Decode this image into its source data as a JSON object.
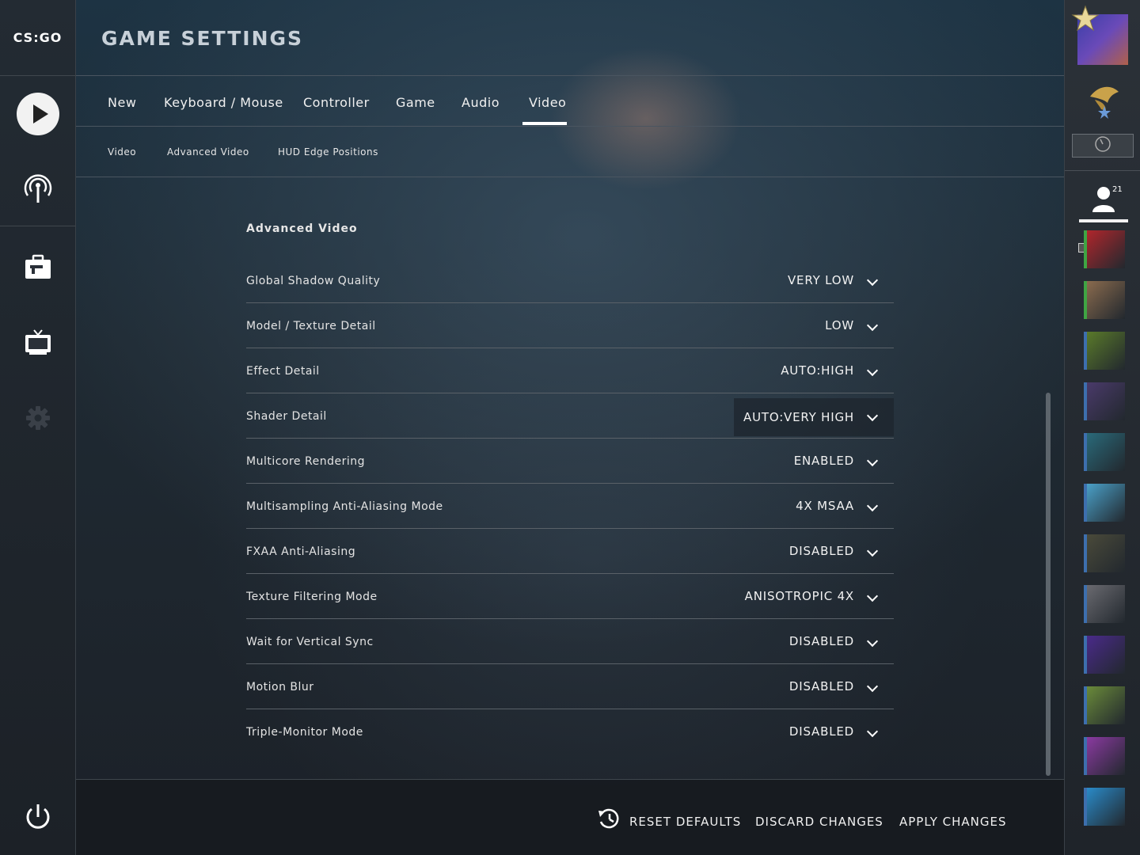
{
  "leftnav": {
    "logo_text": "CS:GO",
    "icons": [
      "play-icon",
      "broadcast-icon",
      "inventory-icon",
      "watch-tv-icon",
      "settings-gear-icon",
      "power-icon"
    ]
  },
  "header": {
    "title": "GAME SETTINGS"
  },
  "tabs": [
    {
      "label": "New"
    },
    {
      "label": "Keyboard / Mouse"
    },
    {
      "label": "Controller"
    },
    {
      "label": "Game"
    },
    {
      "label": "Audio"
    },
    {
      "label": "Video",
      "active": true
    }
  ],
  "subtabs": [
    {
      "label": "Video"
    },
    {
      "label": "Advanced Video"
    },
    {
      "label": "HUD Edge Positions"
    }
  ],
  "section": {
    "title": "Advanced Video",
    "settings": [
      {
        "label": "Global Shadow Quality",
        "value": "VERY LOW"
      },
      {
        "label": "Model / Texture Detail",
        "value": "LOW"
      },
      {
        "label": "Effect Detail",
        "value": "AUTO:HIGH"
      },
      {
        "label": "Shader Detail",
        "value": "AUTO:VERY HIGH",
        "hovered": true
      },
      {
        "label": "Multicore Rendering",
        "value": "ENABLED"
      },
      {
        "label": "Multisampling Anti-Aliasing Mode",
        "value": "4X MSAA"
      },
      {
        "label": "FXAA Anti-Aliasing",
        "value": "DISABLED"
      },
      {
        "label": "Texture Filtering Mode",
        "value": "ANISOTROPIC 4X"
      },
      {
        "label": "Wait for Vertical Sync",
        "value": "DISABLED"
      },
      {
        "label": "Motion Blur",
        "value": "DISABLED"
      },
      {
        "label": "Triple-Monitor Mode",
        "value": "DISABLED"
      }
    ]
  },
  "footer": {
    "reset_label": "RESET DEFAULTS",
    "discard_label": "DISCARD CHANGES",
    "apply_label": "APPLY CHANGES"
  },
  "friends": {
    "count": "21",
    "avatar_colors": [
      "#b0262c",
      "#8a6b4e",
      "#5a7a2a",
      "#4a3a6a",
      "#2a6a7a",
      "#4aa0c8",
      "#4a4a3a",
      "#6a6a70",
      "#4a2a8a",
      "#6a8a3a",
      "#8a3aa0",
      "#2a8ac8"
    ],
    "online_flags": [
      true,
      true,
      false,
      false,
      false,
      false,
      false,
      false,
      false,
      false,
      false,
      false
    ]
  },
  "colors": {
    "accent": "#ffffff",
    "online": "#3fa543",
    "ingame": "#3d6fae"
  }
}
